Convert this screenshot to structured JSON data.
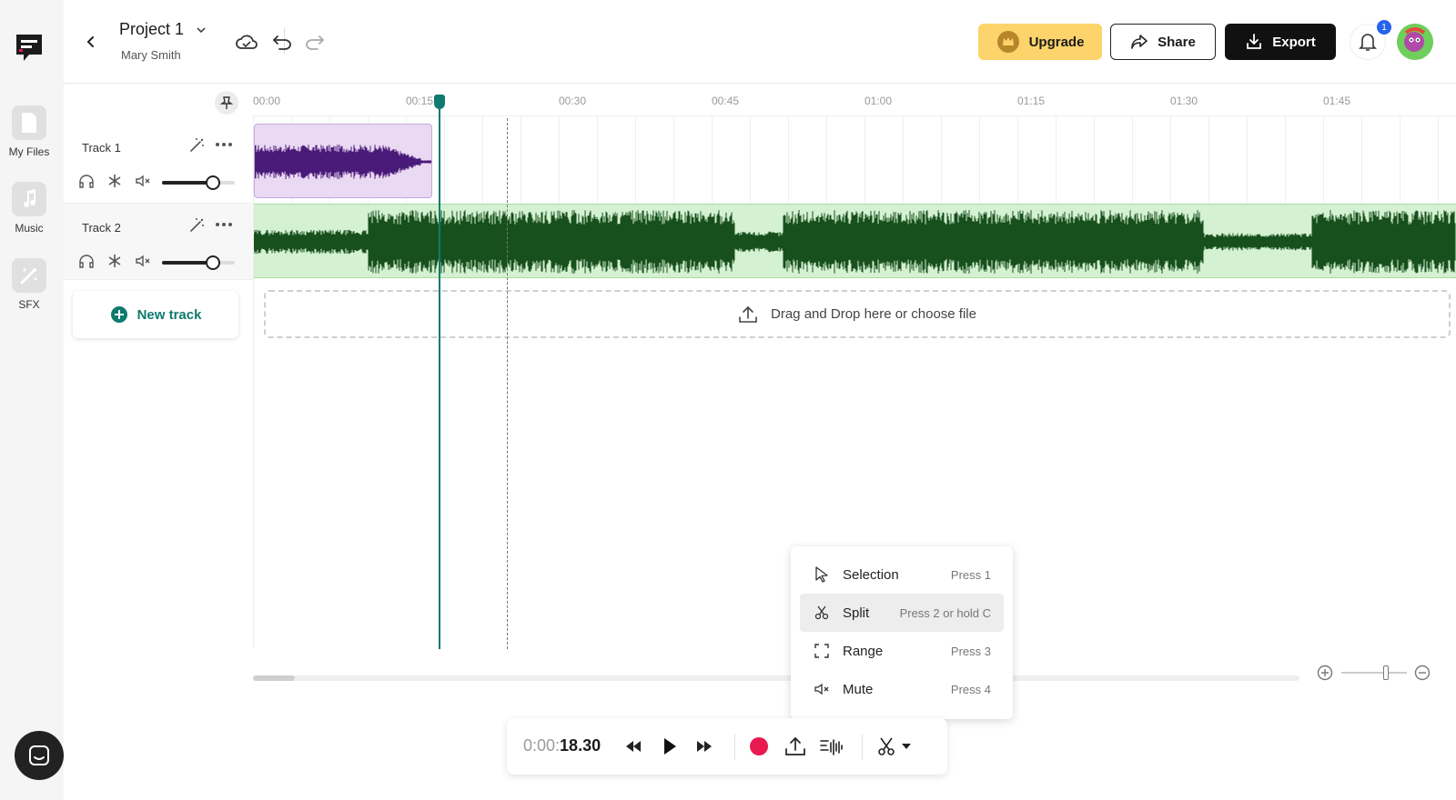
{
  "header": {
    "project_title": "Project 1",
    "owner": "Mary Smith",
    "upgrade_label": "Upgrade",
    "share_label": "Share",
    "export_label": "Export",
    "notification_count": "1"
  },
  "sidebar": {
    "items": [
      {
        "label": "My Files"
      },
      {
        "label": "Music"
      },
      {
        "label": "SFX"
      }
    ]
  },
  "timeline": {
    "ticks": [
      "00:00",
      "00:15",
      "00:30",
      "00:45",
      "01:00",
      "01:15",
      "01:30",
      "01:45"
    ],
    "playhead_time": "00:15"
  },
  "tracks": [
    {
      "name": "Track 1",
      "volume": 0.75
    },
    {
      "name": "Track 2",
      "volume": 0.75
    }
  ],
  "new_track_label": "New track",
  "dropzone_label": "Drag and Drop here or choose file",
  "transport": {
    "time_prefix": "0:00:",
    "time_value": "18.30"
  },
  "tool_menu": {
    "items": [
      {
        "label": "Selection",
        "shortcut": "Press 1",
        "icon": "cursor-icon"
      },
      {
        "label": "Split",
        "shortcut": "Press 2 or hold C",
        "icon": "scissors-icon",
        "active": true
      },
      {
        "label": "Range",
        "shortcut": "Press 3",
        "icon": "range-icon"
      },
      {
        "label": "Mute",
        "shortcut": "Press 4",
        "icon": "mute-icon"
      }
    ]
  },
  "colors": {
    "accent": "#0f7a6e",
    "clip1_bg": "#ead9f3",
    "clip1_wave": "#4a1a78",
    "clip2_bg": "#d4f1d1",
    "clip2_wave": "#17501d",
    "record": "#e8194f",
    "upgrade": "#fcd46b"
  }
}
